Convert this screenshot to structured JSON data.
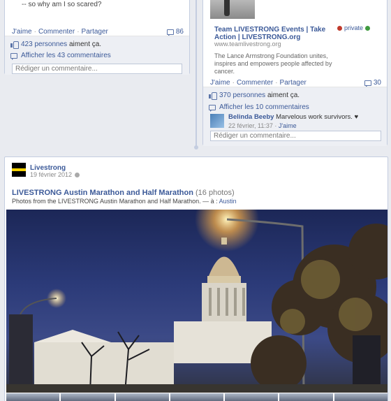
{
  "left_post": {
    "quote": "-- so why am I so scared?",
    "actions": {
      "like": "J'aime",
      "comment": "Commenter",
      "share": "Partager"
    },
    "comment_count": "86",
    "likes_text": "423 personnes",
    "likes_suffix": "aiment ça.",
    "show_comments": "Afficher les 43 commentaires",
    "comment_placeholder": "Rédiger un commentaire..."
  },
  "right_post": {
    "link_title": "Team LIVESTRONG Events | Take Action | LIVESTRONG.org",
    "link_url": "www.teamlivestrong.org",
    "link_desc": "The Lance Armstrong Foundation unites, inspires and empowers people affected by cancer.",
    "privacy": "private",
    "actions": {
      "like": "J'aime",
      "comment": "Commenter",
      "share": "Partager"
    },
    "comment_count": "30",
    "likes_text": "370 personnes",
    "likes_suffix": "aiment ça.",
    "show_comments": "Afficher les 10 commentaires",
    "comment": {
      "author": "Belinda Beeby",
      "text": "Marvelous work survivors. ♥",
      "date": "22 février, 11:37",
      "like": "J'aime"
    },
    "comment_placeholder": "Rédiger un commentaire..."
  },
  "photo_post": {
    "author": "Livestrong",
    "date": "19 février 2012",
    "album_title": "LIVESTRONG Austin Marathon and Half Marathon",
    "album_count": "(16 photos)",
    "desc": "Photos from the LIVESTRONG Austin Marathon and Half Marathon. — à :",
    "location": "Austin"
  }
}
